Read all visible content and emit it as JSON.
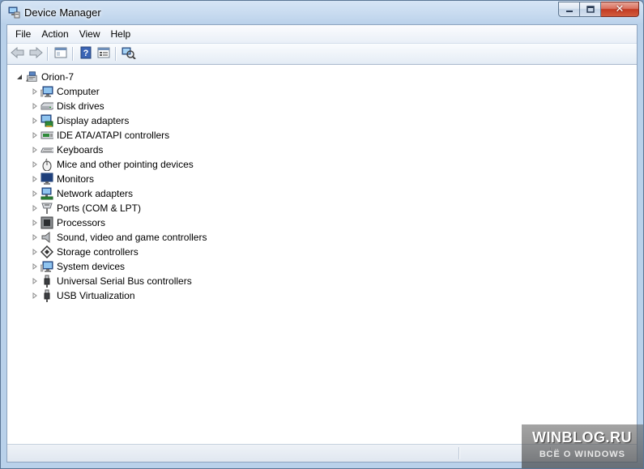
{
  "window": {
    "title": "Device Manager",
    "icon": "device-manager-icon",
    "buttons": {
      "minimize": "minimize-icon",
      "maximize": "maximize-icon",
      "close": "close-icon"
    }
  },
  "menubar": {
    "items": [
      {
        "label": "File"
      },
      {
        "label": "Action"
      },
      {
        "label": "View"
      },
      {
        "label": "Help"
      }
    ]
  },
  "toolbar": {
    "buttons": [
      {
        "name": "back-button",
        "icon": "back-arrow-icon"
      },
      {
        "name": "forward-button",
        "icon": "forward-arrow-icon"
      },
      {
        "name": "show-hide-console-tree-button",
        "icon": "console-tree-icon"
      },
      {
        "name": "help-button",
        "icon": "help-icon"
      },
      {
        "name": "properties-button",
        "icon": "properties-icon"
      },
      {
        "name": "scan-hardware-button",
        "icon": "scan-hardware-icon"
      }
    ]
  },
  "tree": {
    "root": {
      "label": "Orion-7",
      "expanded": true,
      "icon": "computer-root-icon"
    },
    "children": [
      {
        "label": "Computer",
        "icon": "computer-icon"
      },
      {
        "label": "Disk drives",
        "icon": "disk-drive-icon"
      },
      {
        "label": "Display adapters",
        "icon": "display-adapter-icon"
      },
      {
        "label": "IDE ATA/ATAPI controllers",
        "icon": "ide-controller-icon"
      },
      {
        "label": "Keyboards",
        "icon": "keyboard-icon"
      },
      {
        "label": "Mice and other pointing devices",
        "icon": "mouse-icon"
      },
      {
        "label": "Monitors",
        "icon": "monitor-icon"
      },
      {
        "label": "Network adapters",
        "icon": "network-adapter-icon"
      },
      {
        "label": "Ports (COM & LPT)",
        "icon": "port-icon"
      },
      {
        "label": "Processors",
        "icon": "processor-icon"
      },
      {
        "label": "Sound, video and game controllers",
        "icon": "sound-icon"
      },
      {
        "label": "Storage controllers",
        "icon": "storage-controller-icon"
      },
      {
        "label": "System devices",
        "icon": "system-devices-icon"
      },
      {
        "label": "Universal Serial Bus controllers",
        "icon": "usb-icon"
      },
      {
        "label": "USB Virtualization",
        "icon": "usb-icon"
      }
    ]
  },
  "watermark": {
    "line1": "WINBLOG.RU",
    "line2": "ВСЁ О WINDOWS"
  },
  "colors": {
    "title_bar": "#c4d8ee",
    "close_button": "#c23b23",
    "window_border": "#5a7594"
  }
}
